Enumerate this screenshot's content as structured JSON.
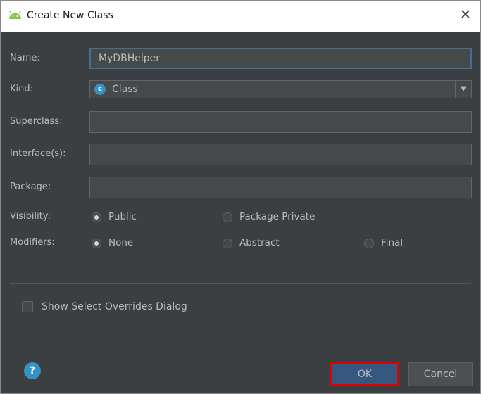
{
  "window": {
    "title": "Create New Class",
    "close_glyph": "✕",
    "icon": "android-icon"
  },
  "form": {
    "name_label": "Name:",
    "name_value": "MyDBHelper",
    "kind_label": "Kind:",
    "kind_value": "Class",
    "kind_icon_letter": "c",
    "kind_arrow": "▼",
    "superclass_label": "Superclass:",
    "superclass_value": "",
    "interfaces_label": "Interface(s):",
    "interfaces_value": "",
    "package_label": "Package:",
    "package_value": "",
    "visibility_label": "Visibility:",
    "visibility_options": [
      "Public",
      "Package Private"
    ],
    "visibility_selected": "Public",
    "modifiers_label": "Modifiers:",
    "modifier_options": [
      "None",
      "Abstract",
      "Final"
    ],
    "modifier_selected": "None",
    "show_overrides_label": "Show Select Overrides Dialog",
    "show_overrides_checked": false
  },
  "buttons": {
    "help": "?",
    "ok": "OK",
    "cancel": "Cancel"
  },
  "colors": {
    "background": "#3c3f41",
    "accent": "#3592c4",
    "ok_highlight": "#e00000",
    "focus_border": "#466d94"
  }
}
